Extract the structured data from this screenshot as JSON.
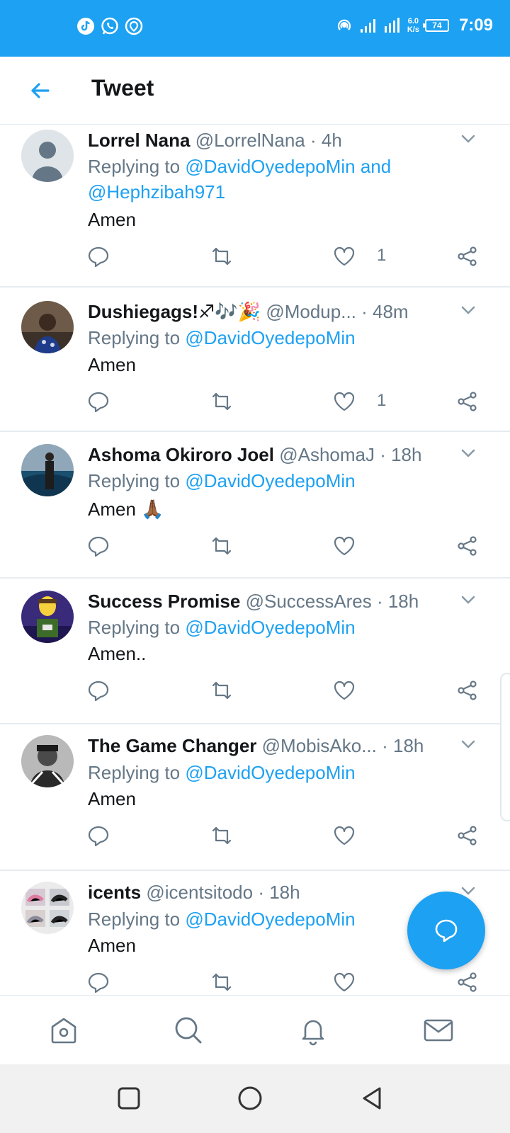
{
  "status_bar": {
    "time": "7:09",
    "net_speed_value": "6.0",
    "net_speed_unit": "K/s",
    "battery": "74",
    "left_icons": [
      "tiktok-icon",
      "whatsapp-icon",
      "location-icon"
    ],
    "right_icons": [
      "hotspot-icon",
      "signal-icon",
      "signal-icon"
    ]
  },
  "header": {
    "title": "Tweet",
    "back_icon": "back-arrow-icon"
  },
  "tweets": [
    {
      "name": "Lorrel Nana",
      "handle": "@LorrelNana",
      "time": "· 4h",
      "replying_prefix": "Replying to ",
      "mention1": "@DavidOyedepoMin",
      "joiner": " and ",
      "mention2": "@Hephzibah971",
      "text": "Amen",
      "likes": "1"
    },
    {
      "name": "Dushiegags!♐🎶🎉",
      "handle": "@Modup...",
      "time": "· 48m",
      "replying_prefix": "Replying to ",
      "mention1": "@DavidOyedepoMin",
      "text": "Amen",
      "likes": "1"
    },
    {
      "name": "Ashoma Okiroro Joel",
      "handle": "@AshomaJ",
      "time": "· 18h",
      "replying_prefix": "Replying to ",
      "mention1": "@DavidOyedepoMin",
      "text": "Amen 🙏🏾",
      "likes": ""
    },
    {
      "name": "Success Promise",
      "handle": "@SuccessAres",
      "time": "· 18h",
      "replying_prefix": "Replying to ",
      "mention1": "@DavidOyedepoMin",
      "text": "Amen..",
      "likes": ""
    },
    {
      "name": "The Game Changer",
      "handle": "@MobisAko...",
      "time": "· 18h",
      "replying_prefix": "Replying to ",
      "mention1": "@DavidOyedepoMin",
      "text": "Amen",
      "likes": ""
    },
    {
      "name": "icents",
      "handle": "@icentsitodo",
      "time": "· 18h",
      "replying_prefix": "Replying to ",
      "mention1": "@DavidOyedepoMin",
      "text": "Amen",
      "likes": ""
    }
  ],
  "bottom_nav": [
    "home-icon",
    "search-icon",
    "notifications-icon",
    "messages-icon"
  ],
  "colors": {
    "accent": "#1da1f2",
    "text": "#14171a",
    "secondary": "#657786",
    "divider": "#e6ecf0"
  }
}
